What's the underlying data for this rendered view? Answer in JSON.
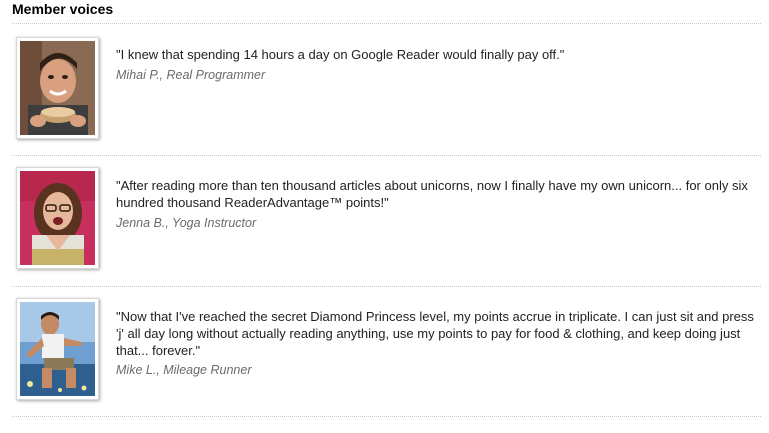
{
  "section": {
    "title": "Member voices"
  },
  "testimonials": [
    {
      "quote": "\"I knew that spending 14 hours a day on Google Reader would finally pay off.\"",
      "author": "Mihai P., Real Programmer"
    },
    {
      "quote": "\"After reading more than ten thousand articles about unicorns, now I finally have my own unicorn... for only six hundred thousand ReaderAdvantage™ points!\"",
      "author": "Jenna B., Yoga Instructor"
    },
    {
      "quote": "\"Now that I've reached the secret Diamond Princess level, my points accrue in triplicate. I can just sit and press 'j' all day long without actually reading anything, use my points to pay for food & clothing, and keep doing just that... forever.\"",
      "author": "Mike L., Mileage Runner"
    }
  ]
}
